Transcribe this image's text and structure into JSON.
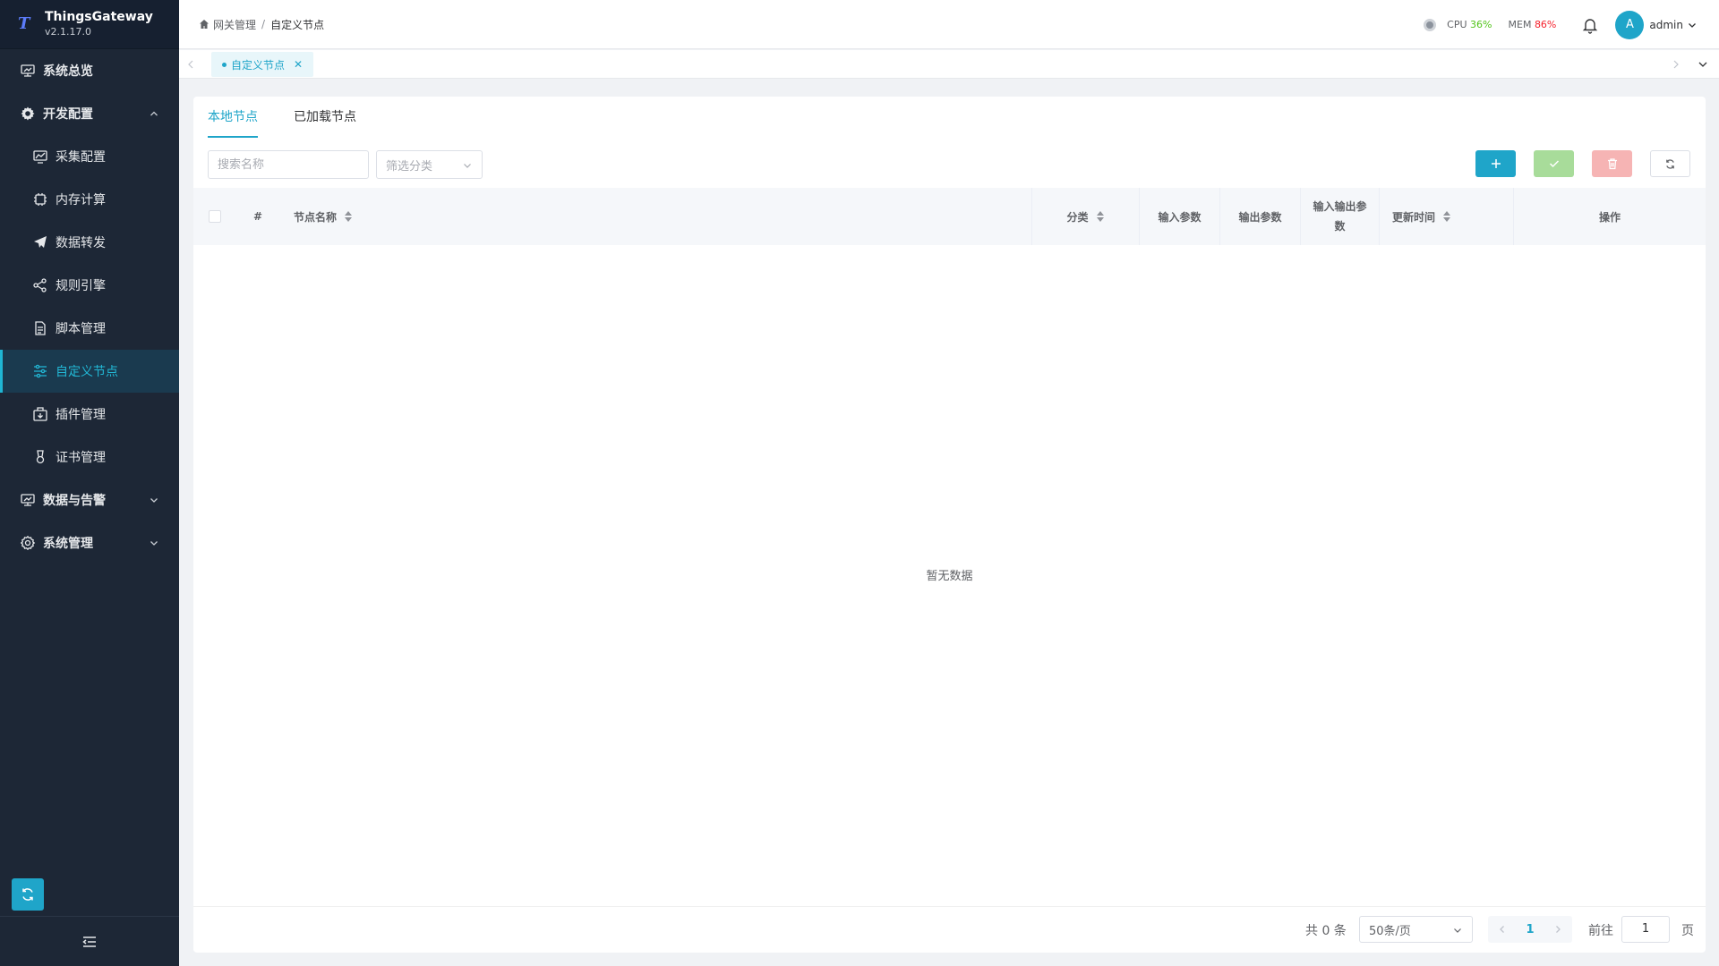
{
  "brand": {
    "name": "ThingsGateway",
    "version": "v2.1.17.0"
  },
  "sidebar": {
    "items": [
      {
        "label": "系统总览",
        "icon": "monitor-icon"
      },
      {
        "label": "开发配置",
        "icon": "gear-icon"
      },
      {
        "label": "采集配置",
        "icon": "chart-icon"
      },
      {
        "label": "内存计算",
        "icon": "chip-icon"
      },
      {
        "label": "数据转发",
        "icon": "send-icon"
      },
      {
        "label": "规则引擎",
        "icon": "share-icon"
      },
      {
        "label": "脚本管理",
        "icon": "file-icon"
      },
      {
        "label": "自定义节点",
        "icon": "sliders-icon"
      },
      {
        "label": "插件管理",
        "icon": "package-icon"
      },
      {
        "label": "证书管理",
        "icon": "certificate-icon"
      },
      {
        "label": "数据与告警",
        "icon": "dashboard-icon"
      },
      {
        "label": "系统管理",
        "icon": "settings-icon"
      }
    ]
  },
  "header": {
    "breadcrumb": [
      "网关管理",
      "自定义节点"
    ],
    "cpu_label": "CPU",
    "cpu_value": "36%",
    "mem_label": "MEM",
    "mem_value": "86%",
    "avatar_letter": "A",
    "user": "admin",
    "colors": {
      "cpu": "#52c41a",
      "mem": "#f5222d",
      "accent": "#1fa5c9"
    }
  },
  "tabbar": {
    "tab_label": "自定义节点",
    "close": "✕"
  },
  "main": {
    "tabs": [
      "本地节点",
      "已加载节点"
    ],
    "search_placeholder": "搜索名称",
    "filter_placeholder": "筛选分类",
    "columns": [
      "#",
      "节点名称",
      "分类",
      "输入参数",
      "输出参数",
      "输入输出参数",
      "更新时间",
      "操作"
    ],
    "empty_text": "暂无数据"
  },
  "pagination": {
    "total": "共 0 条",
    "page_size": "50条/页",
    "current_page": "1",
    "goto_label": "前往",
    "goto_value": "1",
    "page_suffix": "页"
  }
}
